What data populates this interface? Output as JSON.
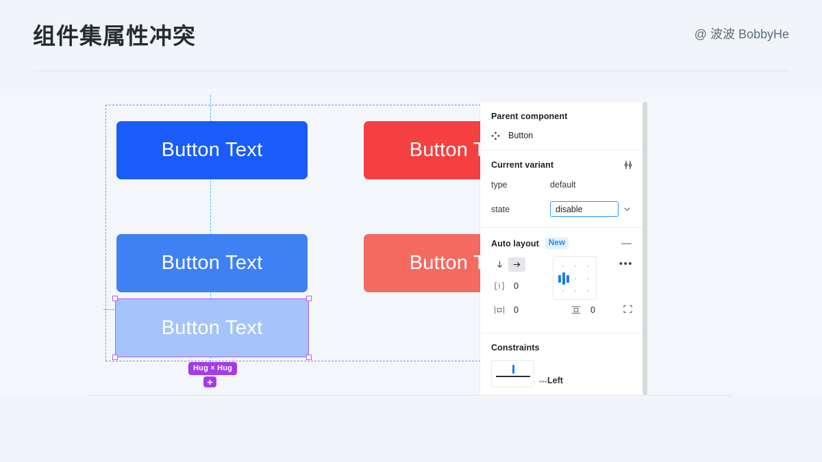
{
  "slide": {
    "title": "组件集属性冲突",
    "author": "@ 波波 BobbyHe"
  },
  "canvas": {
    "buttons": [
      {
        "label": "Button Text",
        "state": "default",
        "color": "#1a5cfa"
      },
      {
        "label": "Button Text",
        "state": "default-danger",
        "color": "#f44040"
      },
      {
        "label": "Button Text",
        "state": "hover",
        "color": "#4080f5"
      },
      {
        "label": "Button Text",
        "state": "hover-danger",
        "color": "#f56a60"
      },
      {
        "label": "Button Text",
        "state": "disable",
        "color": "#a5c4fb"
      }
    ],
    "selection": {
      "size_badge": "Hug × Hug",
      "add_icon": "plus-icon",
      "frame_color": "#b35ef0"
    },
    "guide_color": "#35bdf0",
    "frame_border_color": "#9a7cf0"
  },
  "inspector": {
    "parent_component": {
      "title": "Parent component",
      "icon": "component-diamond-icon",
      "name": "Button"
    },
    "current_variant": {
      "title": "Current variant",
      "tune_icon": "variant-tune-icon",
      "properties": [
        {
          "name": "type",
          "value": "default"
        },
        {
          "name": "state",
          "value": "disable"
        }
      ],
      "chevron_icon": "chevron-down-icon",
      "focus_color": "#1a9cf5"
    },
    "auto_layout": {
      "title": "Auto layout",
      "badge": "New",
      "remove_label": "—",
      "direction": {
        "vertical_icon": "arrow-down-icon",
        "horizontal_icon": "arrow-right-icon",
        "selected": "horizontal"
      },
      "spacing": {
        "icon": "spacing-icon",
        "value": "0"
      },
      "padding_horizontal": {
        "icon": "padding-horizontal-icon",
        "value": "0"
      },
      "padding_vertical": {
        "icon": "padding-vertical-icon",
        "value": "0"
      },
      "alignment": {
        "icon": "alignment-grid-icon",
        "selected": "middle-left"
      },
      "more_label": "•••",
      "clip_icon": "clip-content-icon"
    },
    "constraints": {
      "title": "Constraints",
      "widget_icon": "constraint-widget-icon",
      "value": "Left",
      "value_prefix": "•••"
    },
    "scrollbar": "panel-scrollbar"
  }
}
